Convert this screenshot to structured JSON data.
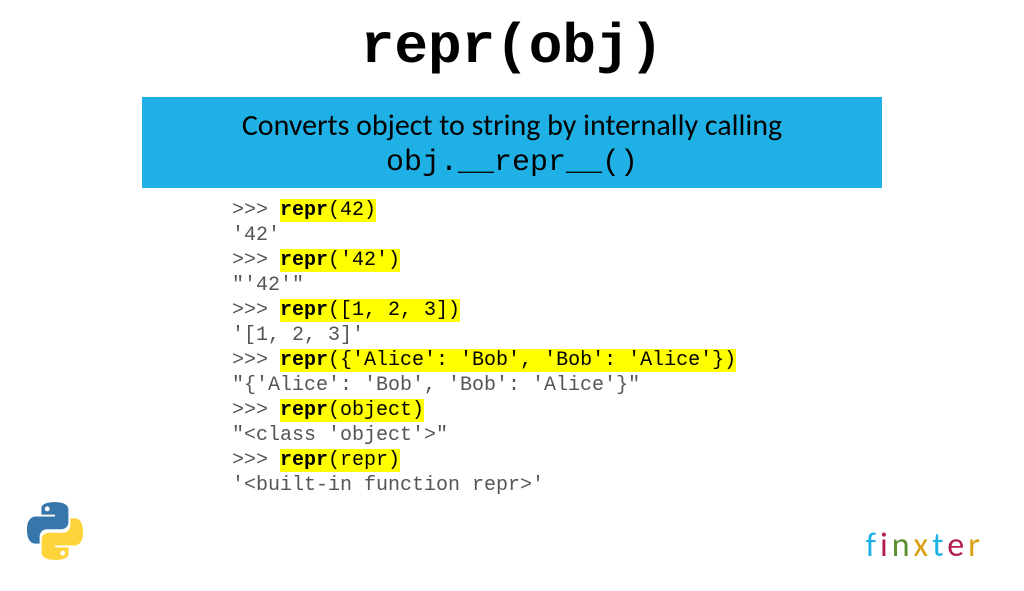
{
  "title": "repr(obj)",
  "subtitle": {
    "line1": "Converts object to string by internally calling",
    "line2": "obj.__repr__()"
  },
  "code": {
    "p1": ">>> ",
    "r1a": "repr",
    "r1b": "(42)",
    "o1": "'42'",
    "p2": ">>> ",
    "r2a": "repr",
    "r2b": "('42')",
    "o2": "\"'42'\"",
    "p3": ">>> ",
    "r3a": "repr",
    "r3b": "([1, 2, 3])",
    "o3": "'[1, 2, 3]'",
    "p4": ">>> ",
    "r4a": "repr",
    "r4b": "({'Alice': 'Bob', 'Bob': 'Alice'})",
    "o4": "\"{'Alice': 'Bob', 'Bob': 'Alice'}\"",
    "p5": ">>> ",
    "r5a": "repr",
    "r5b": "(object)",
    "o5": "\"<class 'object'>\"",
    "p6": ">>> ",
    "r6a": "repr",
    "r6b": "(repr)",
    "o6": "'<built-in function repr>'"
  },
  "brand": {
    "f": "f",
    "i": "i",
    "n": "n",
    "x": "x",
    "t": "t",
    "e": "e",
    "r": "r"
  }
}
